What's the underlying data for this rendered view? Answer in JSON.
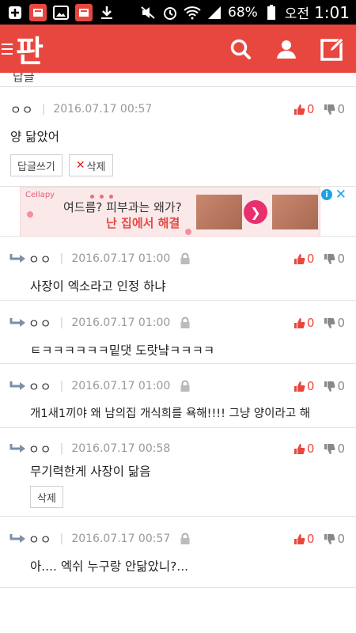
{
  "status_bar": {
    "battery": "68%",
    "ampm": "오전",
    "time": "1:01"
  },
  "app_bar": {
    "logo": "판",
    "icons": [
      "search-icon",
      "person-icon",
      "edit-icon"
    ]
  },
  "cutoff_text": "답글",
  "comments": [
    {
      "nick": "ㅇㅇ",
      "date": "2016.07.17 00:57",
      "up": "0",
      "down": "0",
      "body": "양 닮았어",
      "reply_button": "답글쓰기",
      "delete_button": "삭제"
    },
    {
      "nick": "ㅇㅇ",
      "date": "2016.07.17 01:00",
      "up": "0",
      "down": "0",
      "body": "사장이 엑소라고 인정 하냐"
    },
    {
      "nick": "ㅇㅇ",
      "date": "2016.07.17 01:00",
      "up": "0",
      "down": "0",
      "body": "ㅌㅋㅋㅋㅋㅋㅋ밑댓 도랏냨ㅋㅋㅋㅋ"
    },
    {
      "nick": "ㅇㅇ",
      "date": "2016.07.17 01:00",
      "up": "0",
      "down": "0",
      "body": "개1새1끼야 왜 남의집 개식희를 욕해!!!! 그냥 양이라고 해"
    },
    {
      "nick": "ㅇㅇ",
      "date": "2016.07.17 00:58",
      "up": "0",
      "down": "0",
      "body": "무기력한게 사장이 닮음",
      "delete_button": "삭제"
    },
    {
      "nick": "ㅇㅇ",
      "date": "2016.07.17 00:57",
      "up": "0",
      "down": "0",
      "body": "아.... 엑쉬 누구랑 안닮았니?..."
    }
  ],
  "ad": {
    "brand": "Cellapy",
    "question": "여드름? 피부과는 왜가?",
    "answer": "난 집에서 해결"
  },
  "colors": {
    "brand_red": "#e8473f",
    "ad_background": "#fbe9ea",
    "ad_accent": "#e8306e",
    "divider": "#e2e2e2"
  }
}
